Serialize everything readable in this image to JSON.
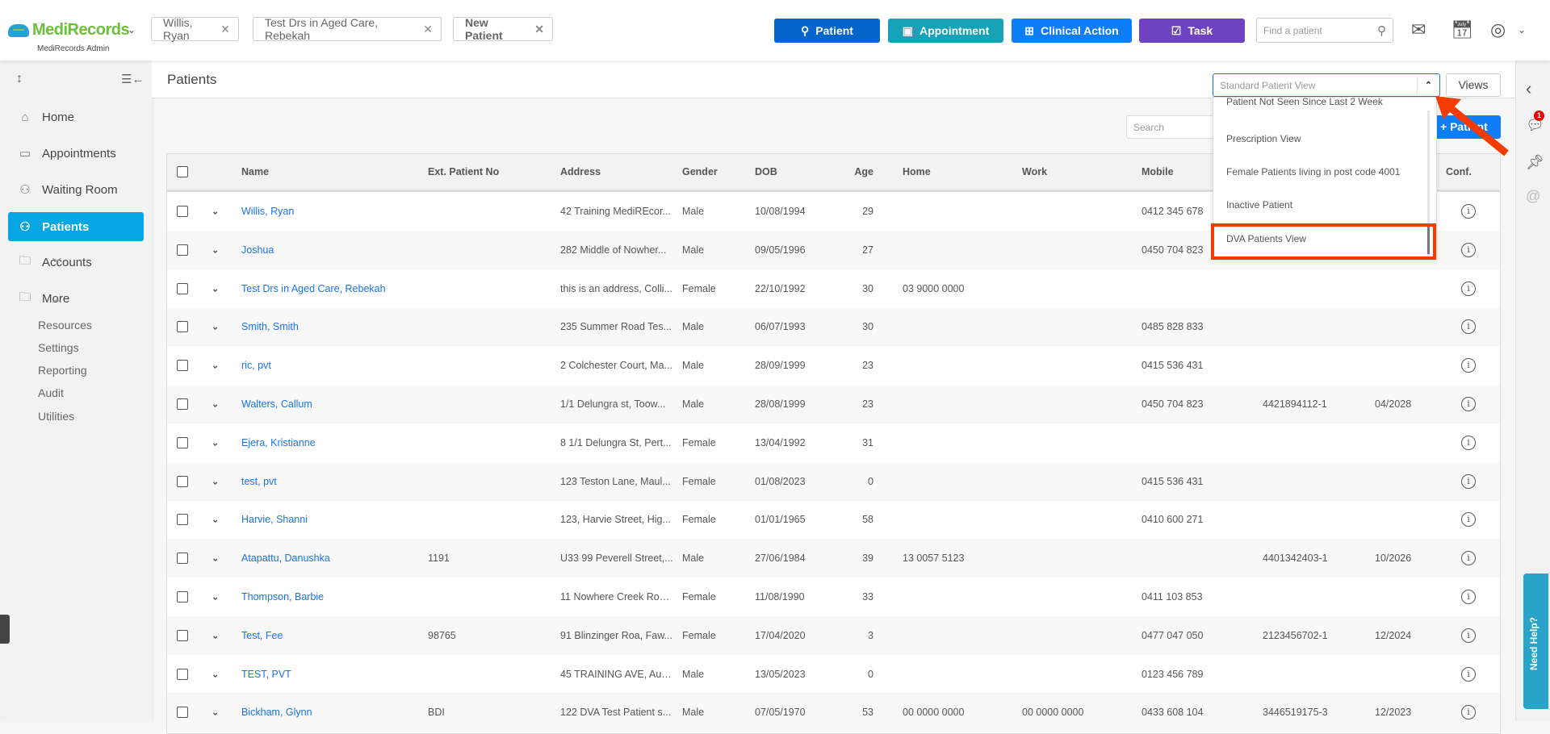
{
  "header": {
    "brand": "MediRecords",
    "brand_sub": "MediRecords Admin",
    "open_tabs": [
      {
        "label": "Willis, Ryan"
      },
      {
        "label": "Test Drs in Aged Care, Rebekah"
      },
      {
        "label": "New Patient"
      }
    ],
    "actions": [
      {
        "label": "Patient",
        "color": "#0665c9",
        "icon": "add-user-icon"
      },
      {
        "label": "Appointment",
        "color": "#17a2b8",
        "icon": "calendar-plus-icon"
      },
      {
        "label": "Clinical Action",
        "color": "#0d7ef7",
        "icon": "clinical-icon"
      },
      {
        "label": "Task",
        "color": "#6f42c1",
        "icon": "clipboard-check-icon"
      }
    ],
    "find_placeholder": "Find a patient"
  },
  "sidebar": {
    "items": [
      {
        "label": "Home",
        "icon": "home-icon"
      },
      {
        "label": "Appointments",
        "icon": "calendar-icon"
      },
      {
        "label": "Waiting Room",
        "icon": "waiting-room-icon"
      },
      {
        "label": "Patients",
        "icon": "patients-icon",
        "active": true
      },
      {
        "label": "Accounts",
        "icon": "folder-icon"
      },
      {
        "label": "More",
        "icon": "folder-plus-icon"
      }
    ],
    "more_items": [
      "Resources",
      "Settings",
      "Reporting",
      "Audit",
      "Utilities"
    ]
  },
  "page": {
    "title": "Patients",
    "search_placeholder": "Search",
    "add_button": "+ Patient",
    "view_select": "Standard Patient View",
    "views_button": "Views",
    "view_options": [
      "Patient Not Seen Since Last 2 Week",
      "Prescription View",
      "Female Patients living in post code 4001",
      "Inactive Patient",
      "DVA Patients View"
    ],
    "highlighted_option": "DVA Patients View"
  },
  "table": {
    "columns": [
      "Name",
      "Ext. Patient No",
      "Address",
      "Gender",
      "DOB",
      "Age",
      "Home",
      "Work",
      "Mobile",
      "",
      "",
      "Conf."
    ],
    "rows": [
      {
        "name": "Willis, Ryan",
        "ext": "",
        "address": "42 Training MediREcor...",
        "gender": "Male",
        "dob": "10/08/1994",
        "age": "29",
        "home": "",
        "work": "",
        "mobile": "0412 345 678",
        "dva": "",
        "expiry": ""
      },
      {
        "name": "Joshua",
        "ext": "",
        "address": "282 Middle of Nowher...",
        "gender": "Male",
        "dob": "09/05/1996",
        "age": "27",
        "home": "",
        "work": "",
        "mobile": "0450 704 823",
        "dva": "",
        "expiry": ""
      },
      {
        "name": "Test Drs in Aged Care, Rebekah",
        "ext": "",
        "address": "this is an address, Colli...",
        "gender": "Female",
        "dob": "22/10/1992",
        "age": "30",
        "home": "03 9000 0000",
        "work": "",
        "mobile": "",
        "dva": "",
        "expiry": ""
      },
      {
        "name": "Smith, Smith",
        "ext": "",
        "address": "235 Summer Road Tes...",
        "gender": "Male",
        "dob": "06/07/1993",
        "age": "30",
        "home": "",
        "work": "",
        "mobile": "0485 828 833",
        "dva": "",
        "expiry": ""
      },
      {
        "name": "ric, pvt",
        "ext": "",
        "address": "2 Colchester Court, Ma...",
        "gender": "Male",
        "dob": "28/09/1999",
        "age": "23",
        "home": "",
        "work": "",
        "mobile": "0415 536 431",
        "dva": "",
        "expiry": ""
      },
      {
        "name": "Walters, Callum",
        "ext": "",
        "address": "1/1 Delungra st, Toow...",
        "gender": "Male",
        "dob": "28/08/1999",
        "age": "23",
        "home": "",
        "work": "",
        "mobile": "0450 704 823",
        "dva": "4421894112-1",
        "expiry": "04/2028"
      },
      {
        "name": "Ejera, Kristianne",
        "ext": "",
        "address": "8 1/1 Delungra St, Pert...",
        "gender": "Female",
        "dob": "13/04/1992",
        "age": "31",
        "home": "",
        "work": "",
        "mobile": "",
        "dva": "",
        "expiry": ""
      },
      {
        "name": "test, pvt",
        "ext": "",
        "address": "123 Teston Lane, Maul...",
        "gender": "Female",
        "dob": "01/08/2023",
        "age": "0",
        "home": "",
        "work": "",
        "mobile": "0415 536 431",
        "dva": "",
        "expiry": ""
      },
      {
        "name": "Harvie, Shanni",
        "ext": "",
        "address": "123, Harvie Street, Hig...",
        "gender": "Female",
        "dob": "01/01/1965",
        "age": "58",
        "home": "",
        "work": "",
        "mobile": "0410 600 271",
        "dva": "",
        "expiry": ""
      },
      {
        "name": "Atapattu, Danushka",
        "ext": "1191",
        "address": "U33 99 Peverell Street,...",
        "gender": "Male",
        "dob": "27/06/1984",
        "age": "39",
        "home": "13 0057 5123",
        "work": "",
        "mobile": "",
        "dva": "4401342403-1",
        "expiry": "10/2026"
      },
      {
        "name": "Thompson, Barbie",
        "ext": "",
        "address": "11 Nowhere Creek Roa...",
        "gender": "Female",
        "dob": "11/08/1990",
        "age": "33",
        "home": "",
        "work": "",
        "mobile": "0411 103 853",
        "dva": "",
        "expiry": ""
      },
      {
        "name": "Test, Fee",
        "ext": "98765",
        "address": "91 Blinzinger Roa, Faw...",
        "gender": "Female",
        "dob": "17/04/2020",
        "age": "3",
        "home": "",
        "work": "",
        "mobile": "0477 047 050",
        "dva": "2123456702-1",
        "expiry": "12/2024"
      },
      {
        "name": "TEST, PVT",
        "ext": "",
        "address": "45 TRAINING AVE, Aust...",
        "gender": "Male",
        "dob": "13/05/2023",
        "age": "0",
        "home": "",
        "work": "",
        "mobile": "0123 456 789",
        "dva": "",
        "expiry": ""
      },
      {
        "name": "Bickham, Glynn",
        "ext": "BDI",
        "address": "122 DVA Test Patient s...",
        "gender": "Male",
        "dob": "07/05/1970",
        "age": "53",
        "home": "00 0000 0000",
        "work": "00 0000 0000",
        "mobile": "0433 608 104",
        "dva": "3446519175-3",
        "expiry": "12/2023"
      }
    ]
  },
  "rail": {
    "notification_count": "1",
    "help_label": "Need Help?"
  },
  "annotation_color": "#f43c00"
}
